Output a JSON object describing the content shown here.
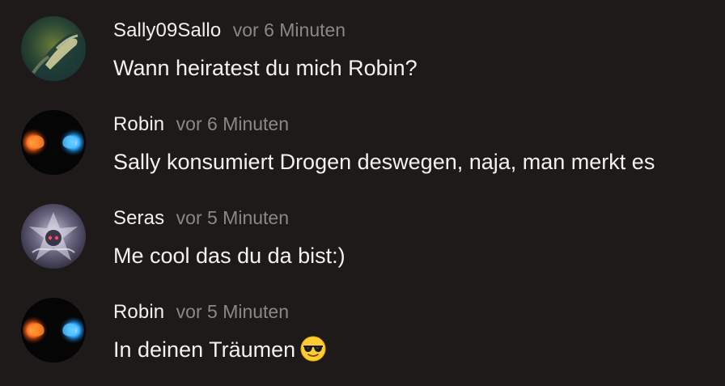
{
  "messages": [
    {
      "username": "Sally09Sallo",
      "time": "vor 6 Minuten",
      "text": "Wann heiratest du mich Robin?"
    },
    {
      "username": "Robin",
      "time": "vor 6 Minuten",
      "text": "Sally konsumiert Drogen deswegen, naja, man merkt es"
    },
    {
      "username": "Seras",
      "time": "vor 5 Minuten",
      "text": "Me cool das du da bist:)"
    },
    {
      "username": "Robin",
      "time": "vor 5 Minuten",
      "text": "In deinen Träumen",
      "emoji": "smiling-face-with-sunglasses"
    }
  ],
  "colors": {
    "background": "#1e1a1a",
    "username": "#f2efef",
    "timestamp": "#8c8787",
    "message_text": "#f4f1f1"
  }
}
